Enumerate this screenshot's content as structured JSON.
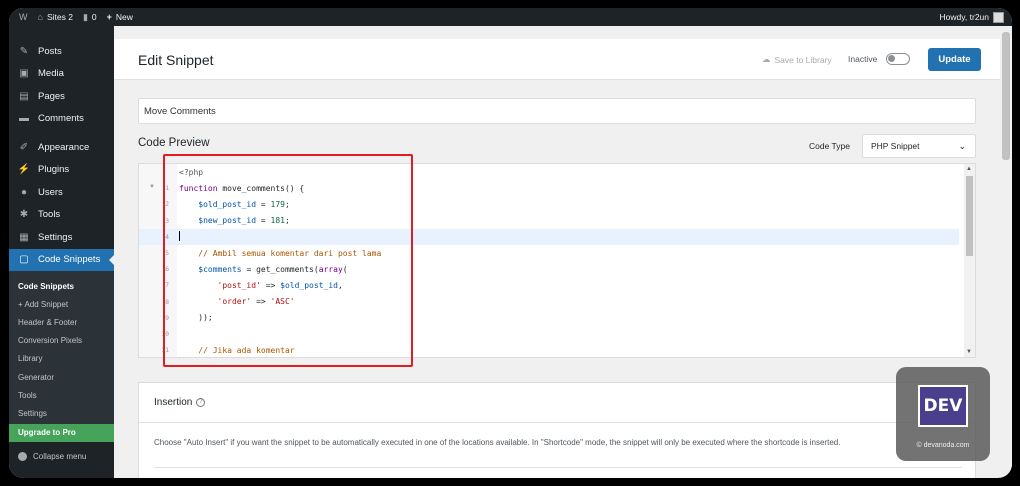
{
  "adminbar": {
    "site_name": "Sites 2",
    "comments_count": "0",
    "new_label": "New",
    "howdy": "Howdy, tr2un"
  },
  "sidebar": {
    "items": [
      {
        "label": "Posts",
        "icon": "pin-icon"
      },
      {
        "label": "Media",
        "icon": "media-icon"
      },
      {
        "label": "Pages",
        "icon": "pages-icon"
      },
      {
        "label": "Comments",
        "icon": "comments-icon"
      },
      {
        "label": "Appearance",
        "icon": "brush-icon"
      },
      {
        "label": "Plugins",
        "icon": "plug-icon"
      },
      {
        "label": "Users",
        "icon": "users-icon"
      },
      {
        "label": "Tools",
        "icon": "wrench-icon"
      },
      {
        "label": "Settings",
        "icon": "settings-icon"
      },
      {
        "label": "Code Snippets",
        "icon": "code-snippets-icon"
      }
    ],
    "submenu": [
      "Code Snippets",
      "+ Add Snippet",
      "Header & Footer",
      "Conversion Pixels",
      "Library",
      "Generator",
      "Tools",
      "Settings"
    ],
    "upgrade": "Upgrade to Pro",
    "collapse": "Collapse menu"
  },
  "header": {
    "title": "Edit Snippet",
    "save_to_library": "Save to Library",
    "status": "Inactive",
    "update_button": "Update"
  },
  "snippet": {
    "title_value": "Move Comments",
    "code_preview_label": "Code Preview",
    "code_type_label": "Code Type",
    "code_type_value": "PHP Snippet",
    "php_open_tag": "<?php",
    "code_lines": [
      "function move_comments() {",
      "    $old_post_id = 179;",
      "    $new_post_id = 181;",
      "",
      "    // Ambil semua komentar dari post lama",
      "    $comments = get_comments(array(",
      "        'post_id' => $old_post_id,",
      "        'order' => 'ASC'",
      "    ));",
      "",
      "    // Jika ada komentar"
    ],
    "line_numbers": [
      "1",
      "2",
      "3",
      "4",
      "5",
      "6",
      "7",
      "8",
      "9",
      "10",
      "11"
    ]
  },
  "insertion": {
    "title": "Insertion",
    "description": "Choose \"Auto Insert\" if you want the snippet to be automatically executed in one of the locations available. In \"Shortcode\" mode, the snippet will only be executed where the shortcode is inserted."
  },
  "watermark": {
    "logo_text": "DEV",
    "site": "© devanoda.com"
  },
  "colors": {
    "admin_dark": "#1d2327",
    "accent": "#2271b1",
    "upgrade_green": "#46a35a",
    "highlight_red": "#e11d24"
  }
}
